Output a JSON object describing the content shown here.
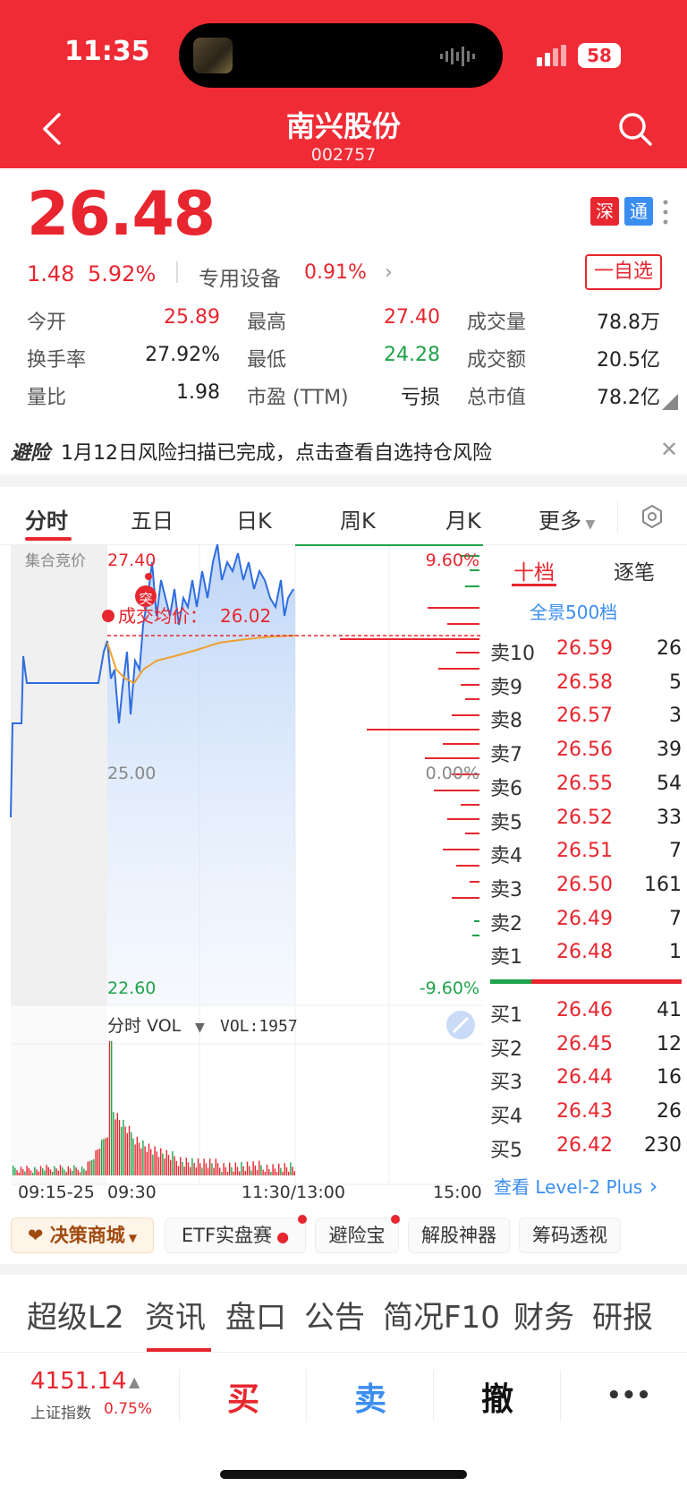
{
  "status": {
    "time": "11:35",
    "battery": "58"
  },
  "header": {
    "title": "南兴股份",
    "code": "002757"
  },
  "quote": {
    "price": "26.48",
    "change": "1.48",
    "change_pct": "5.92%",
    "sector": "专用设备",
    "sector_pct": "0.91%",
    "badge_shen": "深",
    "badge_tong": "通",
    "watch_label": "一自选"
  },
  "stats": [
    {
      "label": "今开",
      "value": "25.89",
      "color": "#e8262f"
    },
    {
      "label": "最高",
      "value": "27.40",
      "color": "#e8262f"
    },
    {
      "label": "成交量",
      "value": "78.8万",
      "color": "#222222"
    },
    {
      "label": "换手率",
      "value": "27.92%",
      "color": "#222222"
    },
    {
      "label": "最低",
      "value": "24.28",
      "color": "#1fa34a"
    },
    {
      "label": "成交额",
      "value": "20.5亿",
      "color": "#222222"
    },
    {
      "label": "量比",
      "value": "1.98",
      "color": "#222222"
    },
    {
      "label": "市盈 (TTM)",
      "value": "亏损",
      "color": "#222222"
    },
    {
      "label": "总市值",
      "value": "78.2亿",
      "color": "#222222"
    }
  ],
  "notice": {
    "brand": "避险",
    "text": "1月12日风险扫描已完成，点击查看自选持仓风险"
  },
  "chart_tabs": [
    "分时",
    "五日",
    "日K",
    "周K",
    "月K",
    "更多"
  ],
  "chart": {
    "auction_label": "集合竞价",
    "y_top": "27.40",
    "y_mid": "25.00",
    "y_bot": "22.60",
    "pct_top": "9.60%",
    "pct_mid": "0.00%",
    "pct_bot": "-9.60%",
    "avg_label": "成交均价：",
    "avg_value": "26.02",
    "signal_label": "突",
    "vol_selector": "分时 VOL",
    "vol_value": "VOL:1957",
    "x_labels": [
      "09:15-25",
      "09:30",
      "11:30/13:00",
      "15:00"
    ]
  },
  "chart_data": {
    "type": "line",
    "ylim": [
      22.6,
      27.4
    ],
    "series": [
      {
        "values": [
          25.9,
          25.7,
          25.2,
          25.4,
          25.3,
          25.8,
          26.3,
          27.1,
          27.3,
          26.7,
          26.5,
          26.8,
          27.4,
          27.0,
          26.9,
          27.1,
          26.8,
          26.6,
          26.3,
          26.5
        ]
      },
      {
        "values": [
          25.9,
          25.6,
          25.5,
          25.6,
          25.7,
          25.8,
          25.85,
          25.9,
          25.95,
          25.98,
          26.0,
          26.01,
          26.02
        ]
      }
    ]
  },
  "orderbook": {
    "tabs": [
      "十档",
      "逐笔"
    ],
    "panorama": "全景500档",
    "sells": [
      {
        "label": "卖10",
        "price": "26.59",
        "qty": "26"
      },
      {
        "label": "卖9",
        "price": "26.58",
        "qty": "5"
      },
      {
        "label": "卖8",
        "price": "26.57",
        "qty": "3"
      },
      {
        "label": "卖7",
        "price": "26.56",
        "qty": "39"
      },
      {
        "label": "卖6",
        "price": "26.55",
        "qty": "54"
      },
      {
        "label": "卖5",
        "price": "26.52",
        "qty": "33"
      },
      {
        "label": "卖4",
        "price": "26.51",
        "qty": "7"
      },
      {
        "label": "卖3",
        "price": "26.50",
        "qty": "161"
      },
      {
        "label": "卖2",
        "price": "26.49",
        "qty": "7"
      },
      {
        "label": "卖1",
        "price": "26.48",
        "qty": "1"
      }
    ],
    "buys": [
      {
        "label": "买1",
        "price": "26.46",
        "qty": "41"
      },
      {
        "label": "买2",
        "price": "26.45",
        "qty": "12"
      },
      {
        "label": "买3",
        "price": "26.44",
        "qty": "16"
      },
      {
        "label": "买4",
        "price": "26.43",
        "qty": "26"
      },
      {
        "label": "买5",
        "price": "26.42",
        "qty": "230"
      }
    ],
    "level2": "查看 Level-2 Plus"
  },
  "pills": [
    "决策商城",
    "ETF实盘赛",
    "避险宝",
    "解股神器",
    "筹码透视"
  ],
  "news_tabs": [
    "超级L2",
    "资讯",
    "盘口",
    "公告",
    "简况F10",
    "财务",
    "研报"
  ],
  "bottom": {
    "index_value": "4151.14",
    "index_name": "上证指数",
    "index_pct": "0.75%",
    "buy": "买",
    "sell": "卖",
    "cancel": "撤",
    "more": "•••"
  }
}
